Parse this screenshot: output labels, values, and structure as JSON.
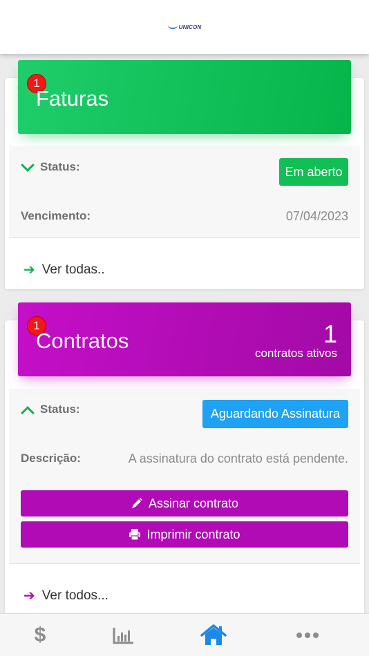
{
  "app": {
    "logo_text": "UNICON"
  },
  "faturas": {
    "badge": "1",
    "title": "Faturas",
    "status_label": "Status:",
    "status_value": "Em aberto",
    "vencimento_label": "Vencimento:",
    "vencimento_value": "07/04/2023",
    "link": "Ver todas.."
  },
  "contratos": {
    "badge": "1",
    "title": "Contratos",
    "count": "1",
    "count_label": "contratos ativos",
    "status_label": "Status:",
    "status_value": "Aguardando Assinatura",
    "descricao_label": "Descrição:",
    "descricao_value": "A assinatura do contrato está pendente.",
    "sign_button": "Assinar contrato",
    "print_button": "Imprimir contrato",
    "link": "Ver todos..."
  },
  "bottom_nav": {
    "items": [
      {
        "icon": "dollar-icon",
        "glyph": "$"
      },
      {
        "icon": "bar-chart-icon"
      },
      {
        "icon": "home-icon",
        "active": true
      },
      {
        "icon": "more-icon"
      }
    ]
  },
  "colors": {
    "green": "#0bb552",
    "purple": "#b10bb5",
    "blue": "#1fa1f4",
    "nav_active": "#1e88e5",
    "nav_inactive": "#8c8c8c"
  }
}
